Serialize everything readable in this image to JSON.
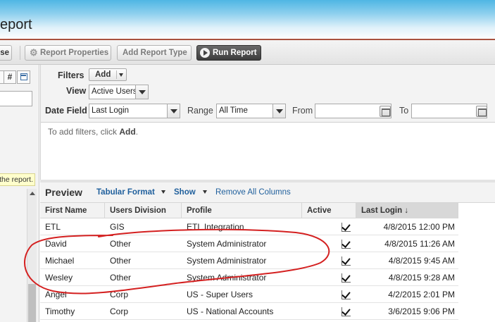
{
  "header": {
    "title_fragment": "eport"
  },
  "toolbar": {
    "close_label": "se",
    "report_properties": "Report Properties",
    "add_report_type": "Add Report Type",
    "run_report": "Run Report"
  },
  "left_panel": {
    "btn_hash": "#",
    "tooltip": "the report."
  },
  "filters": {
    "filters_label": "Filters",
    "add_button": "Add",
    "view_label": "View",
    "view_value": "Active Users",
    "date_field_label": "Date Field",
    "date_field_value": "Last Login",
    "range_label": "Range",
    "range_value": "All Time",
    "from_label": "From",
    "to_label": "To",
    "hint_prefix": "To add filters, click ",
    "hint_bold": "Add",
    "hint_suffix": "."
  },
  "preview": {
    "title": "Preview",
    "format": "Tabular Format",
    "show": "Show",
    "remove_all": "Remove All Columns"
  },
  "table": {
    "columns": [
      "First Name",
      "Users Division",
      "Profile",
      "Active",
      "Last Login ↓"
    ],
    "rows": [
      {
        "first": "ETL",
        "division": "GIS",
        "profile": "ETL Integration",
        "active": true,
        "last_login": "4/8/2015 12:00 PM"
      },
      {
        "first": "David",
        "division": "Other",
        "profile": "System Administrator",
        "active": true,
        "last_login": "4/8/2015 11:26 AM"
      },
      {
        "first": "Michael",
        "division": "Other",
        "profile": "System Administrator",
        "active": true,
        "last_login": "4/8/2015 9:45 AM"
      },
      {
        "first": "Wesley",
        "division": "Other",
        "profile": "System Administrator",
        "active": true,
        "last_login": "4/8/2015 9:28 AM"
      },
      {
        "first": "Angel",
        "division": "Corp",
        "profile": "US - Super Users",
        "active": true,
        "last_login": "4/2/2015 2:01 PM"
      },
      {
        "first": "Timothy",
        "division": "Corp",
        "profile": "US - National Accounts",
        "active": true,
        "last_login": "3/6/2015 9:06 PM"
      }
    ]
  },
  "colors": {
    "header_gradient_top": "#4fb6e4",
    "title_rule": "#a8523f",
    "link": "#1f5f9c",
    "annotation": "#d42020"
  }
}
